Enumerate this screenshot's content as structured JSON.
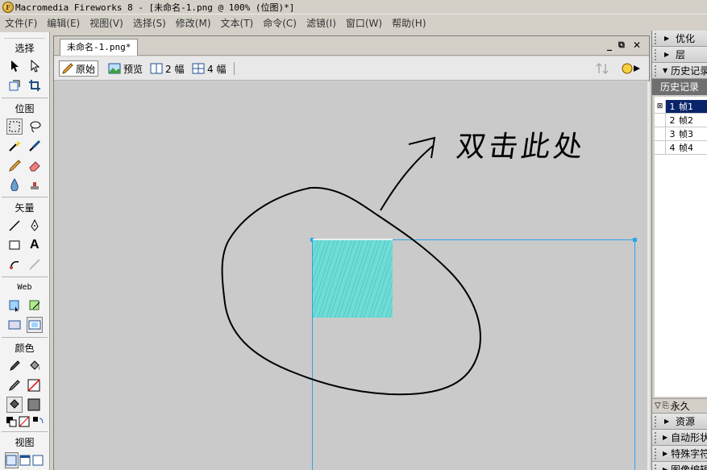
{
  "window": {
    "title": "Macromedia Fireworks 8 - [未命名-1.png @ 100% (位图)*]"
  },
  "menu": [
    "文件(F)",
    "编辑(E)",
    "视图(V)",
    "选择(S)",
    "修改(M)",
    "文本(T)",
    "命令(C)",
    "滤镜(I)",
    "窗口(W)",
    "帮助(H)"
  ],
  "tools": {
    "sections": [
      "选择",
      "位图",
      "矢量",
      "Web",
      "颜色",
      "视图"
    ]
  },
  "document": {
    "tab_label": "未命名-1.png*",
    "view_buttons": [
      "原始",
      "预览",
      "2 幅",
      "4 幅"
    ],
    "annotation": "双击此处"
  },
  "right_panel": {
    "top_panels": [
      "优化",
      "层",
      "历史记录"
    ],
    "history_tab": "历史记录",
    "frames": [
      {
        "num": "1",
        "name": "帧1",
        "selected": true
      },
      {
        "num": "2",
        "name": "帧2",
        "selected": false
      },
      {
        "num": "3",
        "name": "帧3",
        "selected": false
      },
      {
        "num": "4",
        "name": "帧4",
        "selected": false
      }
    ],
    "bottom_toolbar_label": "永久",
    "bottom_panels": [
      "资源",
      "自动形状",
      "特殊字符",
      "图像编辑"
    ]
  },
  "colors": {
    "selection_box": "#2aa5ec",
    "image_fill": "#6fdcd6",
    "frame_selected": "#0a246a"
  }
}
